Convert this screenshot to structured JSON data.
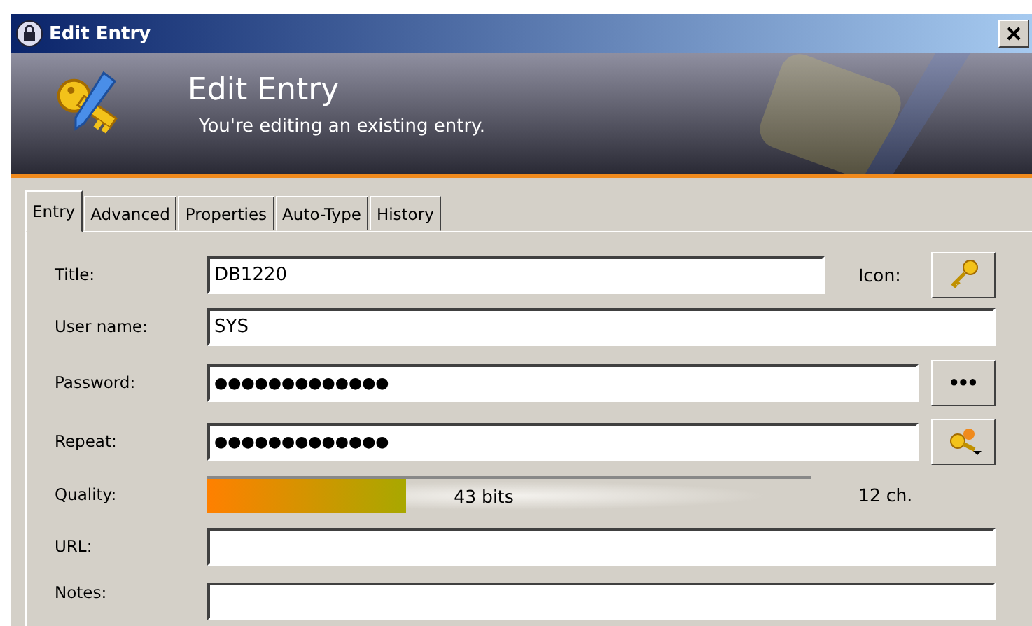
{
  "window": {
    "title": "Edit Entry"
  },
  "banner": {
    "title": "Edit Entry",
    "subtitle": "You're editing an existing entry."
  },
  "tabs": [
    {
      "label": "Entry",
      "selected": true
    },
    {
      "label": "Advanced",
      "selected": false
    },
    {
      "label": "Properties",
      "selected": false
    },
    {
      "label": "Auto-Type",
      "selected": false
    },
    {
      "label": "History",
      "selected": false
    }
  ],
  "form": {
    "title": {
      "label": "Title:",
      "value": "DB1220"
    },
    "icon_label": "Icon:",
    "username": {
      "label": "User name:",
      "value": "SYS"
    },
    "password": {
      "label": "Password:",
      "value": "●●●●●●●●●●●●●",
      "toggle": "●●●"
    },
    "repeat": {
      "label": "Repeat:",
      "value": "●●●●●●●●●●●●●"
    },
    "quality": {
      "label": "Quality:",
      "level": 0.33,
      "reading": "43 bits",
      "length": "12 ch."
    },
    "url": {
      "label": "URL:"
    },
    "notes": {
      "label": "Notes:"
    }
  }
}
